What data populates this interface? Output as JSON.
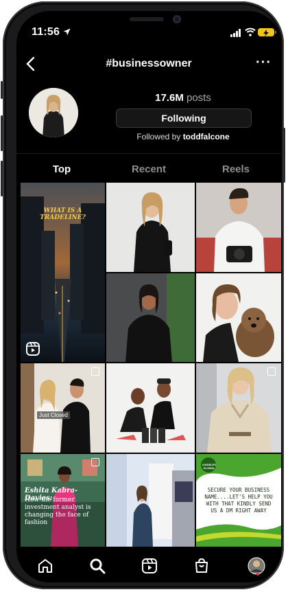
{
  "status_bar": {
    "time": "11:56"
  },
  "header": {
    "hashtag": "#businessowner",
    "more": "···"
  },
  "profile": {
    "post_count": "17.6M",
    "post_label": "posts",
    "follow_button": "Following",
    "followed_by_prefix": "Followed by",
    "followed_by_user": "toddfalcone"
  },
  "tabs": [
    {
      "label": "Top",
      "active": true
    },
    {
      "label": "Recent",
      "active": false
    },
    {
      "label": "Reels",
      "active": false
    }
  ],
  "grid": {
    "posts": [
      {
        "kind": "reel",
        "caption": "WHAT IS A TRADELINE?"
      },
      {
        "kind": "photo",
        "caption": ""
      },
      {
        "kind": "photo",
        "caption": ""
      },
      {
        "kind": "photo",
        "caption": ""
      },
      {
        "kind": "photo",
        "caption": ""
      },
      {
        "kind": "carousel",
        "caption": "Just Closed"
      },
      {
        "kind": "photo",
        "caption": ""
      },
      {
        "kind": "carousel",
        "caption": ""
      },
      {
        "kind": "carousel",
        "name": "Eshita Kabra-Davies:",
        "caption": "How the former investment analyst is changing the face of fashion"
      },
      {
        "kind": "photo",
        "caption": ""
      },
      {
        "kind": "photo",
        "caption": "SECURE YOUR BUSINESS NAME....LET'S HELP YOU WITH THAT KINDLY SEND US A DM RIGHT AWAY",
        "brand": "OASISLEX GLOBAL"
      }
    ]
  },
  "nav": {
    "items": [
      "home-icon",
      "search-icon",
      "reels-icon",
      "shop-icon",
      "profile-avatar"
    ],
    "active": "search-icon"
  }
}
